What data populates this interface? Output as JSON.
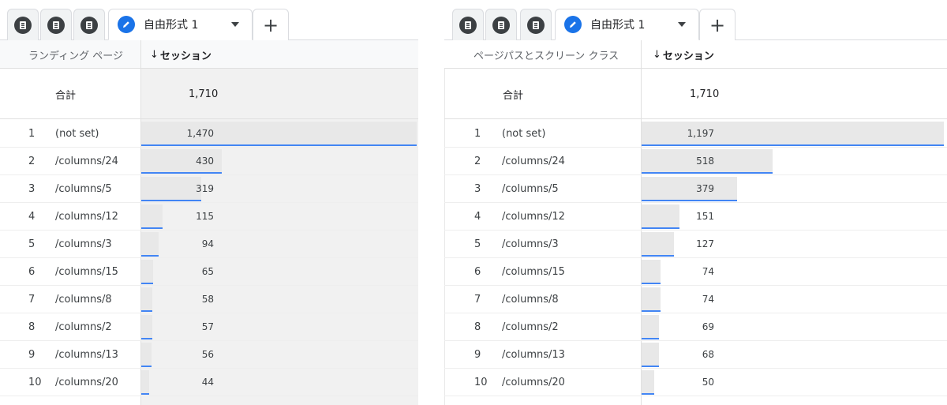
{
  "tabs": {
    "icon_tabs": [
      "report-icon",
      "report-icon",
      "report-icon"
    ],
    "active_label": "自由形式 1",
    "add_label": "+"
  },
  "panels": [
    {
      "dimension_header": "ランディング ページ",
      "metric_header": "セッション",
      "sort_arrow": "↓",
      "total_label": "合計",
      "total_value": "1,710",
      "max": 1470,
      "rows": [
        {
          "rank": "1",
          "dim": "(not set)",
          "value": "1,470",
          "n": 1470
        },
        {
          "rank": "2",
          "dim": "/columns/24",
          "value": "430",
          "n": 430
        },
        {
          "rank": "3",
          "dim": "/columns/5",
          "value": "319",
          "n": 319
        },
        {
          "rank": "4",
          "dim": "/columns/12",
          "value": "115",
          "n": 115
        },
        {
          "rank": "5",
          "dim": "/columns/3",
          "value": "94",
          "n": 94
        },
        {
          "rank": "6",
          "dim": "/columns/15",
          "value": "65",
          "n": 65
        },
        {
          "rank": "7",
          "dim": "/columns/8",
          "value": "58",
          "n": 58
        },
        {
          "rank": "8",
          "dim": "/columns/2",
          "value": "57",
          "n": 57
        },
        {
          "rank": "9",
          "dim": "/columns/13",
          "value": "56",
          "n": 56
        },
        {
          "rank": "10",
          "dim": "/columns/20",
          "value": "44",
          "n": 44
        }
      ]
    },
    {
      "dimension_header": "ページパスとスクリーン クラス",
      "metric_header": "セッション",
      "sort_arrow": "↓",
      "total_label": "合計",
      "total_value": "1,710",
      "max": 1197,
      "rows": [
        {
          "rank": "1",
          "dim": "(not set)",
          "value": "1,197",
          "n": 1197
        },
        {
          "rank": "2",
          "dim": "/columns/24",
          "value": "518",
          "n": 518
        },
        {
          "rank": "3",
          "dim": "/columns/5",
          "value": "379",
          "n": 379
        },
        {
          "rank": "4",
          "dim": "/columns/12",
          "value": "151",
          "n": 151
        },
        {
          "rank": "5",
          "dim": "/columns/3",
          "value": "127",
          "n": 127
        },
        {
          "rank": "6",
          "dim": "/columns/15",
          "value": "74",
          "n": 74
        },
        {
          "rank": "7",
          "dim": "/columns/8",
          "value": "74",
          "n": 74
        },
        {
          "rank": "8",
          "dim": "/columns/2",
          "value": "69",
          "n": 69
        },
        {
          "rank": "9",
          "dim": "/columns/13",
          "value": "68",
          "n": 68
        },
        {
          "rank": "10",
          "dim": "/columns/20",
          "value": "50",
          "n": 50
        }
      ]
    }
  ],
  "colors": {
    "accent": "#1a73e8",
    "bar_fill": "#e8e8e8",
    "bar_line": "#4285f4"
  }
}
